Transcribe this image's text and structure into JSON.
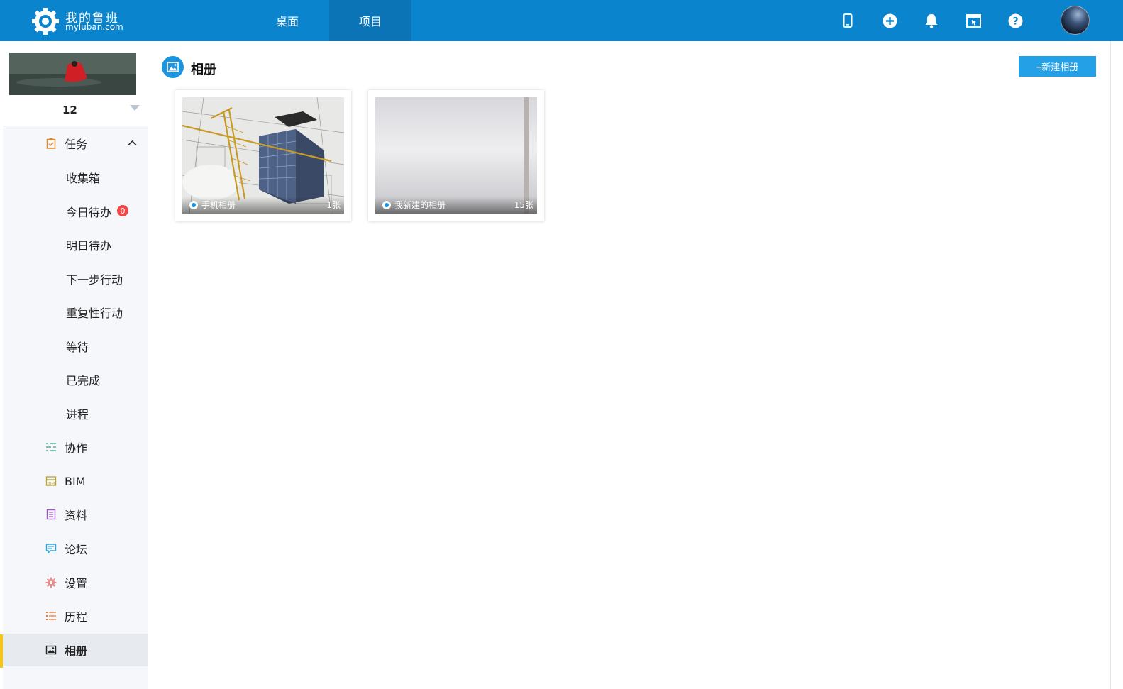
{
  "header": {
    "logo_cn": "我的鲁班",
    "logo_en": "myluban.com",
    "tabs": [
      {
        "label": "桌面",
        "active": false
      },
      {
        "label": "项目",
        "active": true
      }
    ],
    "icons": [
      "mobile-icon",
      "plus-circle-icon",
      "bell-icon",
      "window-pointer-icon",
      "help-icon"
    ],
    "accent_color": "#0a84cd"
  },
  "sidebar": {
    "project_name": "12",
    "menu": [
      {
        "label": "任务",
        "icon": "clipboard-icon",
        "expanded": true
      },
      {
        "label": "收集箱",
        "sub": true
      },
      {
        "label": "今日待办",
        "sub": true,
        "badge": "0"
      },
      {
        "label": "明日待办",
        "sub": true
      },
      {
        "label": "下一步行动",
        "sub": true
      },
      {
        "label": "重复性行动",
        "sub": true
      },
      {
        "label": "等待",
        "sub": true
      },
      {
        "label": "已完成",
        "sub": true
      },
      {
        "label": "进程",
        "sub": true
      },
      {
        "label": "协作",
        "icon": "collab-icon"
      },
      {
        "label": "BIM",
        "icon": "bim-icon"
      },
      {
        "label": "资料",
        "icon": "document-icon"
      },
      {
        "label": "论坛",
        "icon": "forum-icon"
      },
      {
        "label": "设置",
        "icon": "gear-icon"
      },
      {
        "label": "历程",
        "icon": "list-icon"
      },
      {
        "label": "相册",
        "icon": "picture-icon",
        "active": true
      }
    ],
    "active_bar_color": "#f5c518"
  },
  "main": {
    "title": "相册",
    "new_album_label": "+新建相册",
    "albums": [
      {
        "name": "手机相册",
        "count": "1张"
      },
      {
        "name": "我新建的相册",
        "count": "15张"
      }
    ]
  }
}
